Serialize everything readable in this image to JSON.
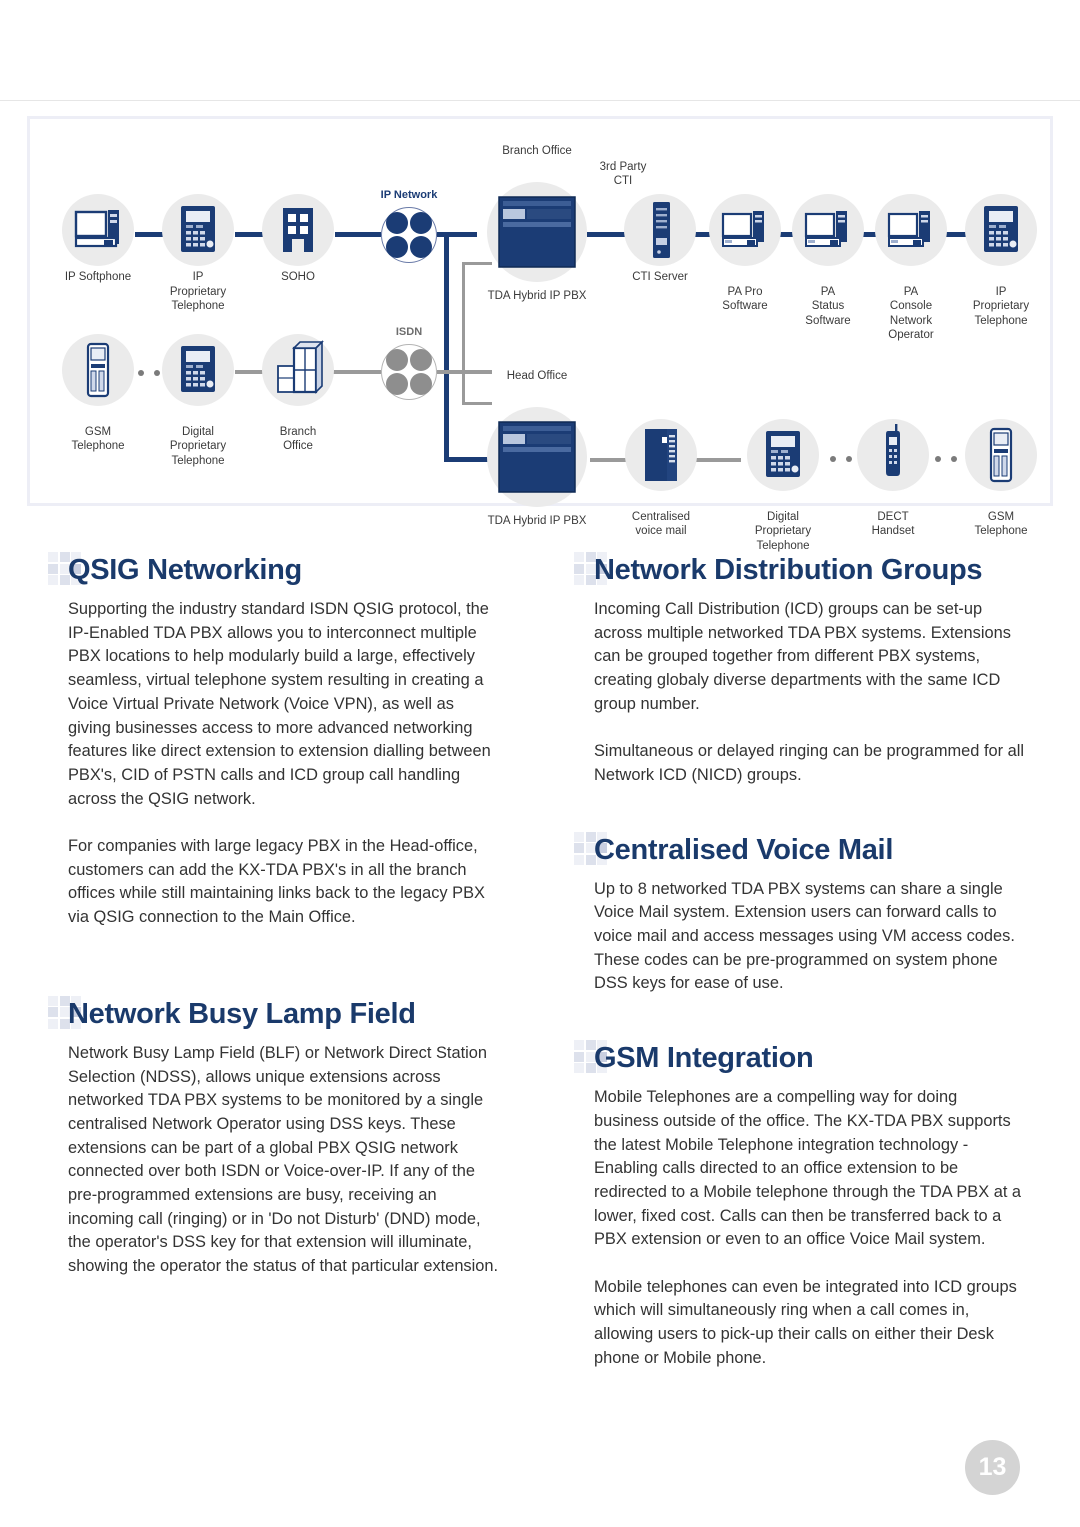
{
  "page": {
    "number": "13"
  },
  "diagram": {
    "title": "KX-TDA networking topology diagram",
    "clouds": [
      {
        "id": "ip-network",
        "label": "IP Network",
        "style": "blue"
      },
      {
        "id": "isdn",
        "label": "ISDN",
        "style": "gray"
      }
    ],
    "area_labels": [
      {
        "id": "branch-office",
        "label": "Branch Office"
      },
      {
        "id": "head-office",
        "label": "Head Office"
      },
      {
        "id": "third-party-cti",
        "label": "3rd Party\nCTI"
      }
    ],
    "nodes_top_left": [
      {
        "id": "ip-softphone",
        "label": "IP Softphone",
        "icon": "desktop-computer-icon"
      },
      {
        "id": "ip-proprietary-telephone",
        "label": "IP Proprietary\nTelephone",
        "icon": "desk-phone-icon"
      },
      {
        "id": "soho",
        "label": "SOHO",
        "icon": "office-building-icon"
      }
    ],
    "nodes_top_right": [
      {
        "id": "tda-hybrid-ip-pbx-branch",
        "label": "TDA Hybrid IP PBX",
        "icon": "pbx-cabinet-icon"
      },
      {
        "id": "cti-server",
        "label": "CTI Server",
        "icon": "server-tower-icon"
      },
      {
        "id": "pa-pro-software",
        "label": "PA Pro\nSoftware",
        "icon": "pc-workstation-icon"
      },
      {
        "id": "pa-status-software",
        "label": "PA Status\nSoftware",
        "icon": "pc-workstation-icon"
      },
      {
        "id": "pa-console-network-operator",
        "label": "PA Console\nNetwork\nOperator",
        "icon": "pc-workstation-icon"
      },
      {
        "id": "ip-proprietary-telephone-right",
        "label": "IP Proprietary\nTelephone",
        "icon": "desk-phone-icon"
      }
    ],
    "nodes_bottom_left": [
      {
        "id": "gsm-telephone-left",
        "label": "GSM\nTelephone",
        "icon": "mobile-phone-icon"
      },
      {
        "id": "digital-proprietary-telephone-left",
        "label": "Digital\nProprietary\nTelephone",
        "icon": "desk-phone-icon"
      },
      {
        "id": "branch-office-building",
        "label": "Branch\nOffice",
        "icon": "office-building-icon"
      }
    ],
    "nodes_bottom_right": [
      {
        "id": "tda-hybrid-ip-pbx-head",
        "label": "TDA Hybrid IP PBX",
        "icon": "pbx-cabinet-icon"
      },
      {
        "id": "centralised-voice-mail",
        "label": "Centralised\nvoice mail",
        "icon": "server-tower-icon"
      },
      {
        "id": "digital-proprietary-telephone-right",
        "label": "Digital\nProprietary\nTelephone",
        "icon": "desk-phone-icon"
      },
      {
        "id": "dect-handset",
        "label": "DECT\nHandset",
        "icon": "cordless-handset-icon"
      },
      {
        "id": "gsm-telephone-right",
        "label": "GSM\nTelephone",
        "icon": "mobile-phone-icon"
      }
    ]
  },
  "colors": {
    "heading": "#1a3a6b",
    "accent_blue": "#1b3c75",
    "line_gray": "#9a9a9a",
    "halo": "#ebebeb",
    "panel_border": "#edeef6",
    "page_badge": "#d4d4d4"
  },
  "left_column": {
    "sections": [
      {
        "id": "qsig-networking",
        "heading": "QSIG Networking",
        "paragraphs": [
          "Supporting the industry standard ISDN QSIG protocol, the IP-Enabled TDA PBX allows you to interconnect multiple PBX locations to help modularly build a large, effectively seamless, virtual telephone system resulting in creating a Voice Virtual Private Network (Voice VPN), as well as giving businesses access to more advanced networking features like direct extension to extension dialling between PBX's, CID of PSTN calls and ICD group call handling across the QSIG network.",
          "For companies with large legacy PBX in the Head-office, customers can add the KX-TDA PBX's in all the branch offices while still maintaining links back to the legacy PBX via QSIG connection to the Main Office."
        ]
      },
      {
        "id": "network-busy-lamp-field",
        "heading": "Network Busy Lamp Field",
        "paragraphs": [
          "Network Busy Lamp Field (BLF) or Network Direct Station Selection (NDSS), allows unique extensions across networked TDA PBX systems to be monitored by a single centralised Network Operator using DSS keys. These extensions can be part of a global PBX QSIG network connected over both ISDN or Voice-over-IP. If any of the pre-programmed extensions are busy, receiving an incoming call (ringing) or in 'Do not Disturb' (DND) mode, the operator's DSS key for that extension will illuminate, showing the operator the status of that particular extension."
        ]
      }
    ]
  },
  "right_column": {
    "sections": [
      {
        "id": "network-distribution-groups",
        "heading": "Network Distribution Groups",
        "paragraphs": [
          "Incoming Call Distribution (ICD) groups can be set-up across multiple networked TDA PBX systems. Extensions can be grouped together from different PBX systems, creating globaly diverse departments with the same ICD group number.",
          "Simultaneous or delayed ringing can be programmed for all Network ICD (NICD) groups."
        ]
      },
      {
        "id": "centralised-voice-mail",
        "heading": "Centralised Voice Mail",
        "paragraphs": [
          "Up to 8 networked TDA PBX systems can share a single Voice Mail system. Extension users can forward calls to voice mail and access messages using VM access codes. These codes can be pre-programmed on system phone DSS keys for ease of use."
        ]
      },
      {
        "id": "gsm-integration",
        "heading": "GSM Integration",
        "paragraphs": [
          "Mobile Telephones  are a compelling way for doing business  outside of the office. The KX-TDA PBX supports the latest Mobile Telephone  integration technology - Enabling calls directed to an office extension to be redirected to a Mobile telephone through the TDA PBX at a lower, fixed cost.  Calls can then be transferred back to a PBX extension or even to an office Voice Mail system.",
          "Mobile telephones can even be integrated into ICD groups which will simultaneously ring when a call comes in, allowing users to pick-up their calls on either their Desk phone or Mobile phone."
        ]
      }
    ]
  }
}
